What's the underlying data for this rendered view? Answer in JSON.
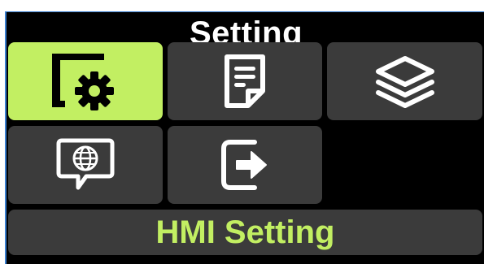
{
  "header": {
    "title": "Setting"
  },
  "menu": {
    "tiles": [
      {
        "icon": "hmi-settings-icon",
        "selected": true
      },
      {
        "icon": "document-icon",
        "selected": false
      },
      {
        "icon": "layers-icon",
        "selected": false
      },
      {
        "icon": "language-globe-icon",
        "selected": false
      },
      {
        "icon": "exit-icon",
        "selected": false
      }
    ]
  },
  "status": {
    "label": "HMI Setting"
  },
  "colors": {
    "accent": "#c2ef62",
    "tile": "#3b3b3b",
    "background": "#000000",
    "text": "#ffffff"
  }
}
